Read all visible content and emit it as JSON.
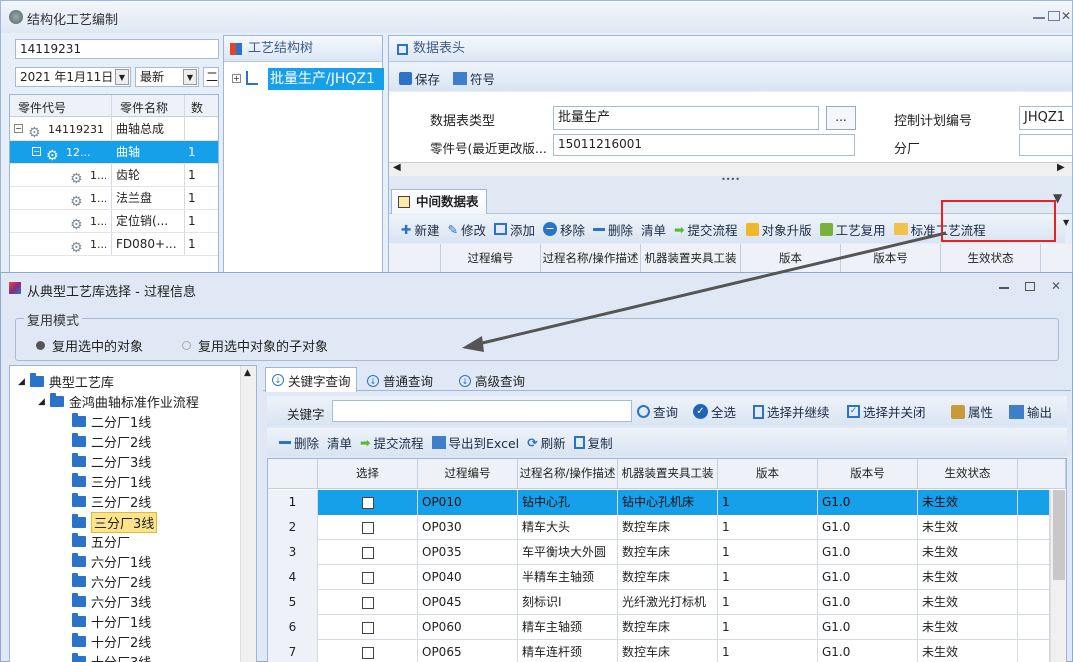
{
  "main_window": {
    "title": "结构化工艺编制",
    "search_value": "14119231",
    "date_value": "2021 年1月11日",
    "version_select": "最新",
    "extra_select": "二",
    "tree_columns": [
      "零件代号",
      "零件名称",
      "数"
    ],
    "tree_rows": [
      {
        "code": "14119231",
        "name": "曲轴总成",
        "qty": ""
      },
      {
        "code": "12...",
        "name": "曲轴",
        "qty": "1"
      },
      {
        "code": "1...",
        "name": "齿轮",
        "qty": "1"
      },
      {
        "code": "1...",
        "name": "法兰盘",
        "qty": "1"
      },
      {
        "code": "1...",
        "name": "定位销(...",
        "qty": "1"
      },
      {
        "code": "1...",
        "name": "FD080+...",
        "qty": "1"
      }
    ],
    "process_tree_title": "工艺结构树",
    "process_tree_node": "批量生产/JHQZ1",
    "header_panel_title": "数据表头",
    "save_label": "保存",
    "symbol_label": "符号",
    "form": {
      "type_label": "数据表类型",
      "type_value": "批量生产",
      "browse_label": "...",
      "plan_label": "控制计划编号",
      "plan_value": "JHQZ1",
      "part_label": "零件号(最近更改版...",
      "part_value": "15011216001",
      "branch_label": "分厂"
    },
    "middle_tab": "中间数据表",
    "toolbar": [
      "新建",
      "修改",
      "添加",
      "移除",
      "删除",
      "清单",
      "提交流程",
      "对象升版",
      "工艺复用",
      "标准工艺流程"
    ],
    "grid_headers": [
      "过程编号",
      "过程名称/操作描述",
      "机器装置夹具工装",
      "版本",
      "版本号",
      "生效状态"
    ]
  },
  "dialog": {
    "title": "从典型工艺库选择 - 过程信息",
    "reuse_group": "复用模式",
    "radio1": "复用选中的对象",
    "radio2": "复用选中对象的子对象",
    "tree_root": "典型工艺库",
    "tree_child": "金鸿曲轴标准作业流程",
    "tree_items": [
      "二分厂1线",
      "二分厂2线",
      "二分厂3线",
      "三分厂1线",
      "三分厂2线",
      "三分厂3线",
      "五分厂",
      "六分厂1线",
      "六分厂2线",
      "六分厂3线",
      "十分厂1线",
      "十分厂2线",
      "十分厂3线"
    ],
    "selected_tree_item": "三分厂3线",
    "tabs": [
      "关键字查询",
      "普通查询",
      "高级查询"
    ],
    "keyword_label": "关键字",
    "keyword_value": "",
    "search_toolbar": [
      "查询",
      "全选",
      "选择并继续",
      "选择并关闭",
      "属性",
      "输出"
    ],
    "action_toolbar": [
      "删除",
      "清单",
      "提交流程",
      "导出到Excel",
      "刷新",
      "复制"
    ],
    "grid_headers": [
      "选择",
      "过程编号",
      "过程名称/操作描述",
      "机器装置夹具工装",
      "版本",
      "版本号",
      "生效状态"
    ],
    "rows": [
      {
        "n": "1",
        "id": "OP010",
        "name": "钻中心孔",
        "machine": "钻中心孔机床",
        "ver": "1",
        "vno": "G1.0",
        "state": "未生效"
      },
      {
        "n": "2",
        "id": "OP030",
        "name": "精车大头",
        "machine": "数控车床",
        "ver": "1",
        "vno": "G1.0",
        "state": "未生效"
      },
      {
        "n": "3",
        "id": "OP035",
        "name": "车平衡块大外圆",
        "machine": "数控车床",
        "ver": "1",
        "vno": "G1.0",
        "state": "未生效"
      },
      {
        "n": "4",
        "id": "OP040",
        "name": "半精车主轴颈",
        "machine": "数控车床",
        "ver": "1",
        "vno": "G1.0",
        "state": "未生效"
      },
      {
        "n": "5",
        "id": "OP045",
        "name": "刻标识I",
        "machine": "光纤激光打标机",
        "ver": "1",
        "vno": "G1.0",
        "state": "未生效"
      },
      {
        "n": "6",
        "id": "OP060",
        "name": "精车主轴颈",
        "machine": "数控车床",
        "ver": "1",
        "vno": "G1.0",
        "state": "未生效"
      },
      {
        "n": "7",
        "id": "OP065",
        "name": "精车连杆颈",
        "machine": "数控车床",
        "ver": "1",
        "vno": "G1.0",
        "state": "未生效"
      }
    ]
  },
  "colors": {
    "highlight": "#ea2121",
    "selection": "#17a0ea",
    "arrow": "#555555"
  }
}
